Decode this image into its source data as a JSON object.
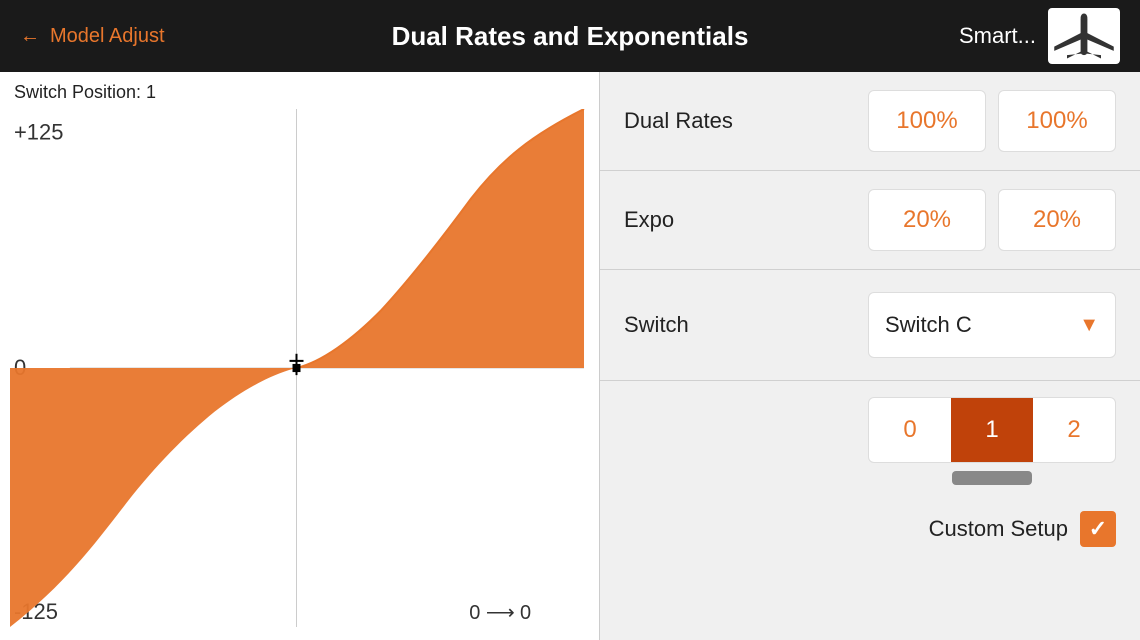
{
  "header": {
    "back_label": "Model Adjust",
    "title": "Dual Rates and Exponentials",
    "model_name": "Smart...",
    "back_arrow": "←"
  },
  "chart": {
    "switch_position_label": "Switch Position: 1",
    "y_max": "+125",
    "y_zero": "0",
    "y_min": "-125",
    "x_label": "0 ⟶ 0",
    "fill_color": "#e8762c"
  },
  "params": {
    "dual_rates": {
      "label": "Dual Rates",
      "value1": "100%",
      "value2": "100%"
    },
    "expo": {
      "label": "Expo",
      "value1": "20%",
      "value2": "20%"
    },
    "switch": {
      "label": "Switch",
      "selected": "Switch C",
      "dropdown_arrow": "▼"
    }
  },
  "switch_selector": {
    "positions": [
      "0",
      "1",
      "2"
    ],
    "active_index": 1
  },
  "custom_setup": {
    "label": "Custom Setup",
    "checked": true,
    "checkmark": "✓"
  }
}
